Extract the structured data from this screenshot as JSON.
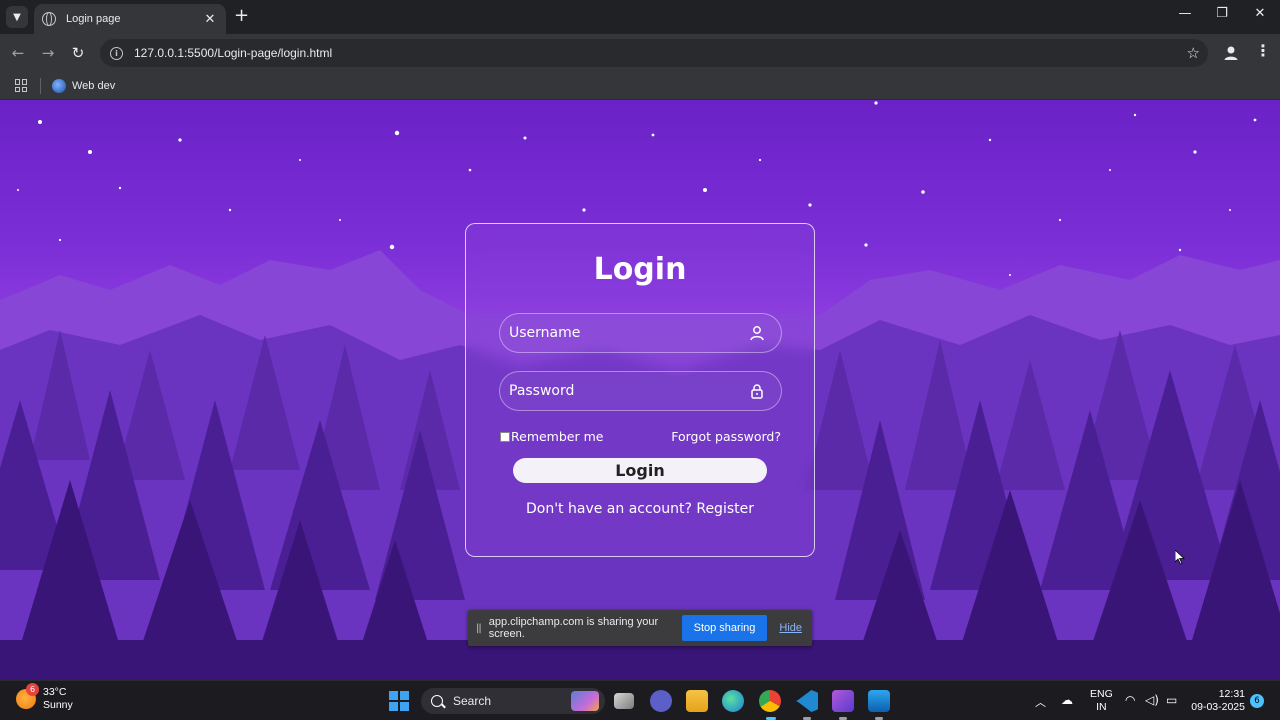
{
  "browser": {
    "tab_title": "Login page",
    "url": "127.0.0.1:5500/Login-page/login.html",
    "bookmark_label": "Web dev"
  },
  "login": {
    "title": "Login",
    "username_placeholder": "Username",
    "password_placeholder": "Password",
    "remember_label": "Remember me",
    "forgot_label": "Forgot password?",
    "button_label": "Login",
    "register_prompt": "Don't have an account? Register"
  },
  "share_bar": {
    "message": "app.clipchamp.com is sharing your screen.",
    "stop_label": "Stop sharing",
    "hide_label": "Hide"
  },
  "taskbar": {
    "weather_badge": "6",
    "weather_temp": "33°C",
    "weather_desc": "Sunny",
    "search_label": "Search",
    "lang_1": "ENG",
    "lang_2": "IN",
    "time": "12:31",
    "date": "09-03-2025",
    "notification_count": "6"
  },
  "icons": {
    "tab_search": "chevron-down-icon",
    "close": "close-icon",
    "new_tab": "plus-icon",
    "back": "arrow-left-icon",
    "forward": "arrow-right-icon",
    "reload": "reload-icon",
    "site_info": "info-icon",
    "bookmark_star": "star-icon",
    "profile": "person-icon",
    "menu": "kebab-menu-icon",
    "username_field": "user-icon",
    "password_field": "lock-icon"
  },
  "colors": {
    "sky_top": "#6a22c7",
    "horizon_glow": "#c05ce6",
    "stop_sharing": "#1a73e8",
    "chrome_dark": "#202124"
  }
}
